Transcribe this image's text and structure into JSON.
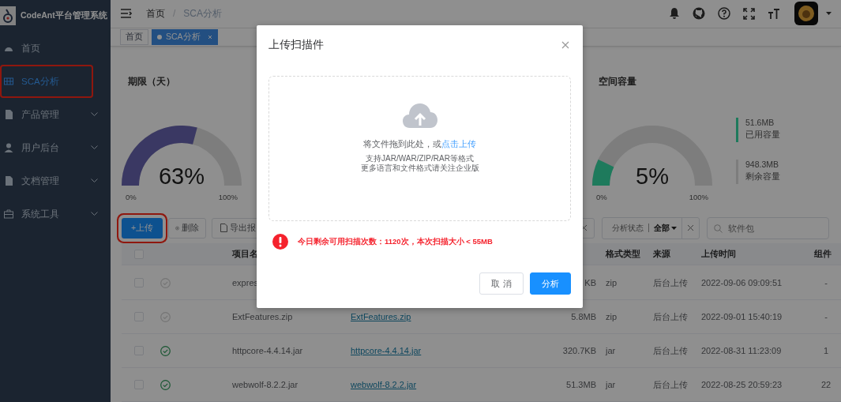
{
  "sidebar": {
    "logo_text": "CodeAnt平台管理系统",
    "items": [
      {
        "label": "首页",
        "kind": "dashboard",
        "selected": false,
        "highlighted": false,
        "has_submenu": false
      },
      {
        "label": "SCA分析",
        "kind": "table",
        "selected": true,
        "highlighted": true,
        "has_submenu": false
      },
      {
        "label": "产品管理",
        "kind": "document",
        "selected": false,
        "highlighted": false,
        "has_submenu": true
      },
      {
        "label": "用户后台",
        "kind": "user",
        "selected": false,
        "highlighted": false,
        "has_submenu": true
      },
      {
        "label": "文档管理",
        "kind": "document",
        "selected": false,
        "highlighted": false,
        "has_submenu": true
      },
      {
        "label": "系统工具",
        "kind": "briefcase",
        "selected": false,
        "highlighted": false,
        "has_submenu": true
      }
    ]
  },
  "breadcrumb": [
    "首页",
    "SCA分析"
  ],
  "breadcrumb_separator": "/",
  "tags": [
    {
      "label": "首页",
      "selected": false
    },
    {
      "label": "SCA分析",
      "selected": true
    }
  ],
  "gauges": [
    {
      "title": "期限（天）",
      "level": 0.63,
      "reading": "63%",
      "min_label": "0%",
      "max_label": "100%",
      "color": "#3a3863"
    },
    {
      "title": "空间容量",
      "level": 0.05,
      "reading": "5%",
      "min_label": "0%",
      "max_label": "100%",
      "color": "#1e7a5c",
      "legend": [
        {
          "value": "51.6MB",
          "label": "已用容量",
          "color": "#1e7a5c"
        },
        {
          "value": "948.3MB",
          "label": "剩余容量",
          "color": "#7d7d7d"
        }
      ]
    }
  ],
  "toolbar": [
    {
      "label": "+上传",
      "kind": "primary",
      "highlighted": true
    },
    {
      "label": "删除",
      "kind": "delete",
      "highlighted": false
    },
    {
      "label": "导出报",
      "kind": "export",
      "highlighted": false
    }
  ],
  "status_filter": {
    "label": "分析状态",
    "value": "全部"
  },
  "search": {
    "placeholder": "软件包"
  },
  "table": {
    "all_checked": false,
    "headers": {
      "name": "项目名",
      "format": "格式类型",
      "source": "来源",
      "time": "上传时间",
      "count": "组件"
    },
    "rows": [
      {
        "checked": false,
        "analyzed": false,
        "name": "expres",
        "size": "KB",
        "format": "zip",
        "source": "后台上传",
        "time": "2022-09-06 09:09:51",
        "count": "-"
      },
      {
        "checked": false,
        "analyzed": false,
        "name": "ExtFeatures.zip",
        "file": "ExtFeatures.zip",
        "size": "5.8MB",
        "format": "zip",
        "source": "后台上传",
        "time": "2022-09-01 15:40:19",
        "count": "-"
      },
      {
        "checked": false,
        "analyzed": true,
        "name": "httpcore-4.4.14.jar",
        "file": "httpcore-4.4.14.jar",
        "size": "320.7KB",
        "format": "jar",
        "source": "后台上传",
        "time": "2022-08-31 11:23:09",
        "count": "1"
      },
      {
        "checked": false,
        "analyzed": true,
        "name": "webwolf-8.2.2.jar",
        "file": "webwolf-8.2.2.jar",
        "size": "51.3MB",
        "format": "jar",
        "source": "后台上传",
        "time": "2022-08-25 20:59:23",
        "count": "22"
      }
    ]
  },
  "dialog": {
    "title": "上传扫描件",
    "drop_text": "将文件拖到此处，或",
    "drop_link": "点击上传",
    "hints": [
      "支持JAR/WAR/ZIP/RAR等格式",
      "更多语言和文件格式请关注企业版"
    ],
    "warning": "今日剩余可用扫描次数：1120次，本次扫描大小 < 55MB",
    "buttons": [
      {
        "label": "取 消",
        "kind": "default"
      },
      {
        "label": "分析",
        "kind": "primary"
      }
    ]
  }
}
